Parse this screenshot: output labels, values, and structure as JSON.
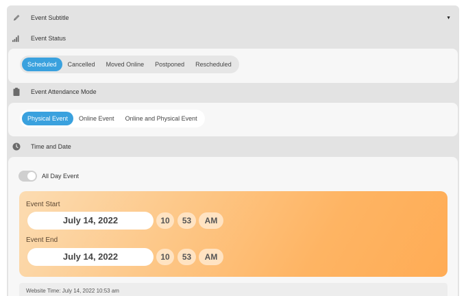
{
  "subtitle": {
    "label": "Event Subtitle",
    "icon": "pencil-icon"
  },
  "status": {
    "label": "Event Status",
    "icon": "signal-bars-icon",
    "options": [
      "Scheduled",
      "Cancelled",
      "Moved Online",
      "Postponed",
      "Rescheduled"
    ],
    "selected": "Scheduled"
  },
  "attendance": {
    "label": "Event Attendance Mode",
    "icon": "clipboard-icon",
    "options": [
      "Physical Event",
      "Online Event",
      "Online and Physical Event"
    ],
    "selected": "Physical Event"
  },
  "time": {
    "label": "Time and Date",
    "icon": "clock-icon",
    "all_day_label": "All Day Event",
    "all_day": false,
    "start": {
      "label": "Event Start",
      "date": "July 14, 2022",
      "hour": "10",
      "minute": "53",
      "ampm": "AM"
    },
    "end": {
      "label": "Event End",
      "date": "July 14, 2022",
      "hour": "10",
      "minute": "53",
      "ampm": "AM"
    },
    "website_time": "Website Time: July 14, 2022 10:53 am"
  },
  "colors": {
    "accent": "#3aa1de",
    "panel": "#e3e3e3",
    "gradient_start": "#fcdcb2",
    "gradient_end": "#ffac55"
  }
}
